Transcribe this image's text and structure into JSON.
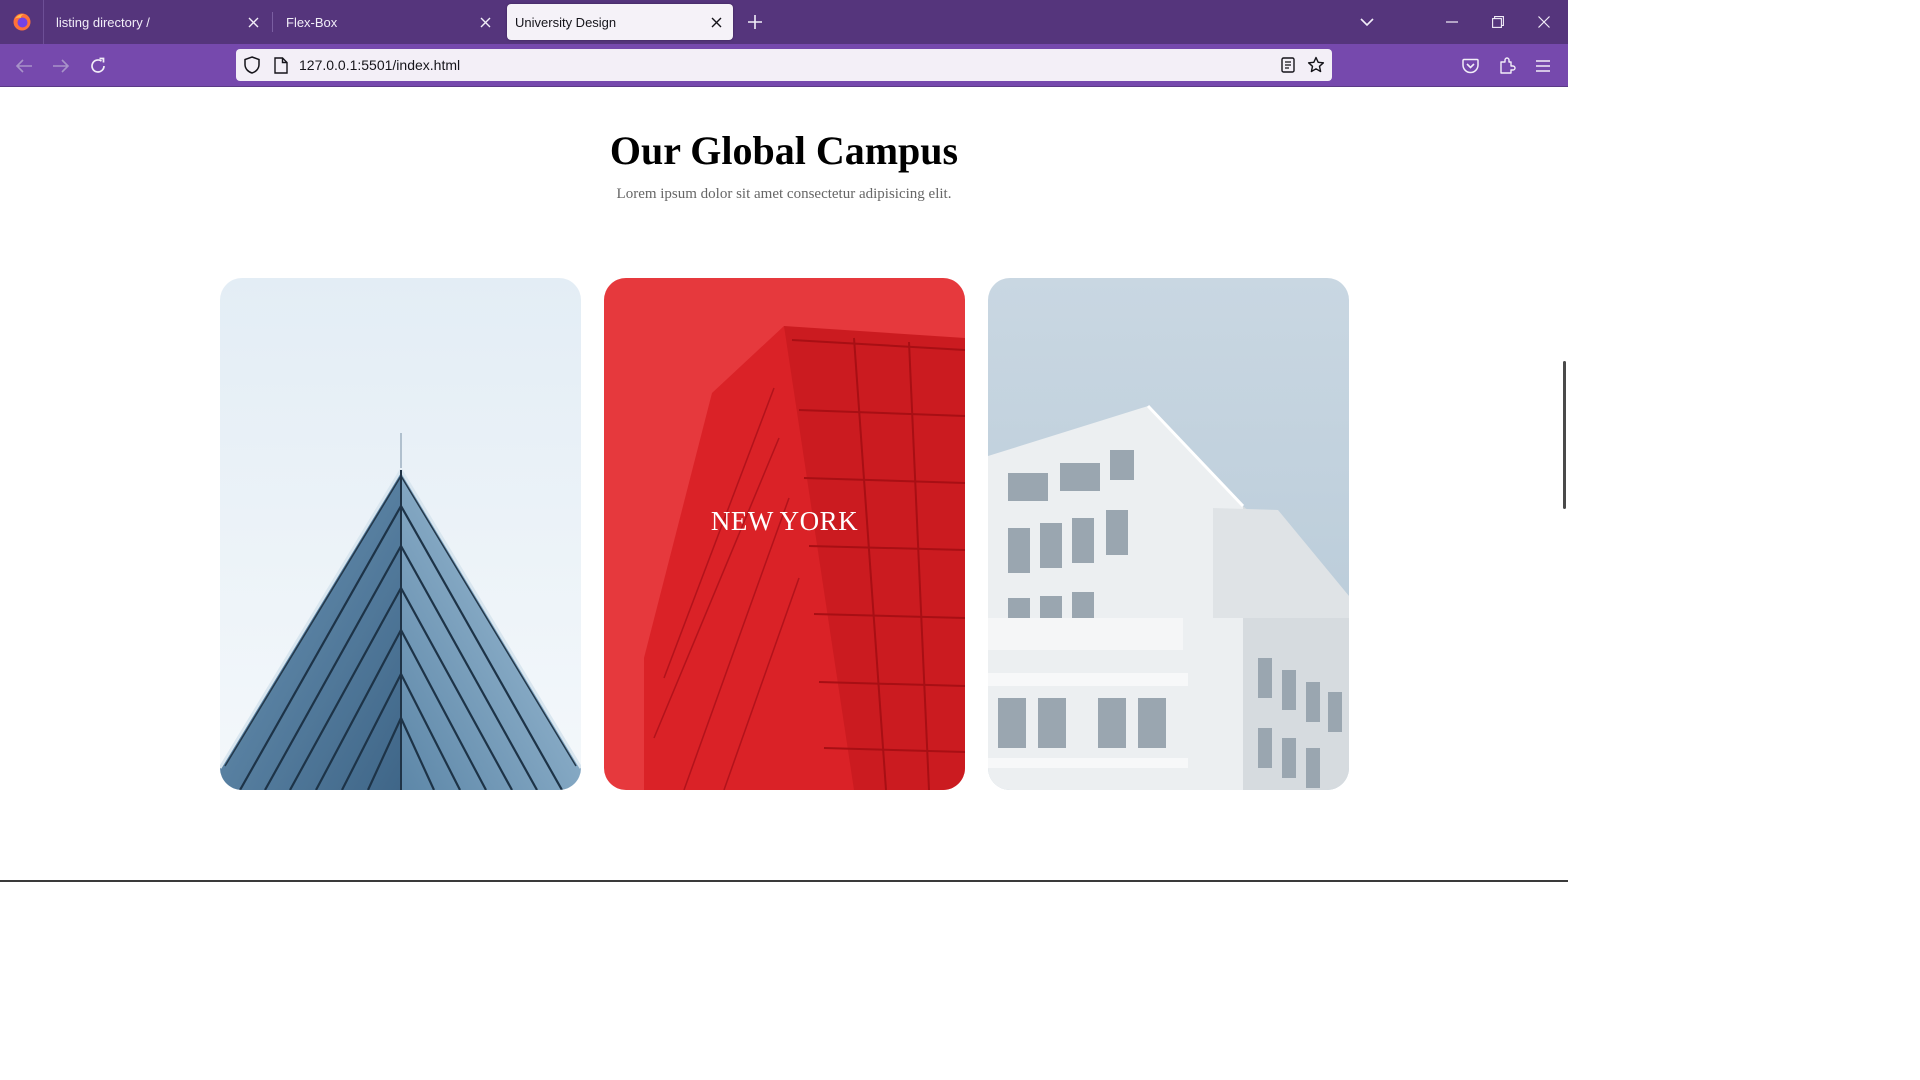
{
  "browser": {
    "tabs": [
      {
        "label": "listing directory /",
        "active": false
      },
      {
        "label": "Flex-Box",
        "active": false
      },
      {
        "label": "University Design",
        "active": true
      }
    ],
    "url": "127.0.0.1:5501/index.html",
    "colors": {
      "tabbar": "#55357c",
      "navbar": "#7649ad",
      "urlbar": "#f3eff7"
    }
  },
  "section": {
    "title": "Our Global Campus",
    "subtitle": "Lorem ipsum dolor sit amet consectetur adipisicing elit."
  },
  "cards": [
    {
      "image": "glass-pyramid-building",
      "caption": ""
    },
    {
      "image": "red-skyscraper",
      "caption": "NEW YORK",
      "overlay_color": "#e8202a"
    },
    {
      "image": "white-modern-building",
      "caption": ""
    }
  ]
}
